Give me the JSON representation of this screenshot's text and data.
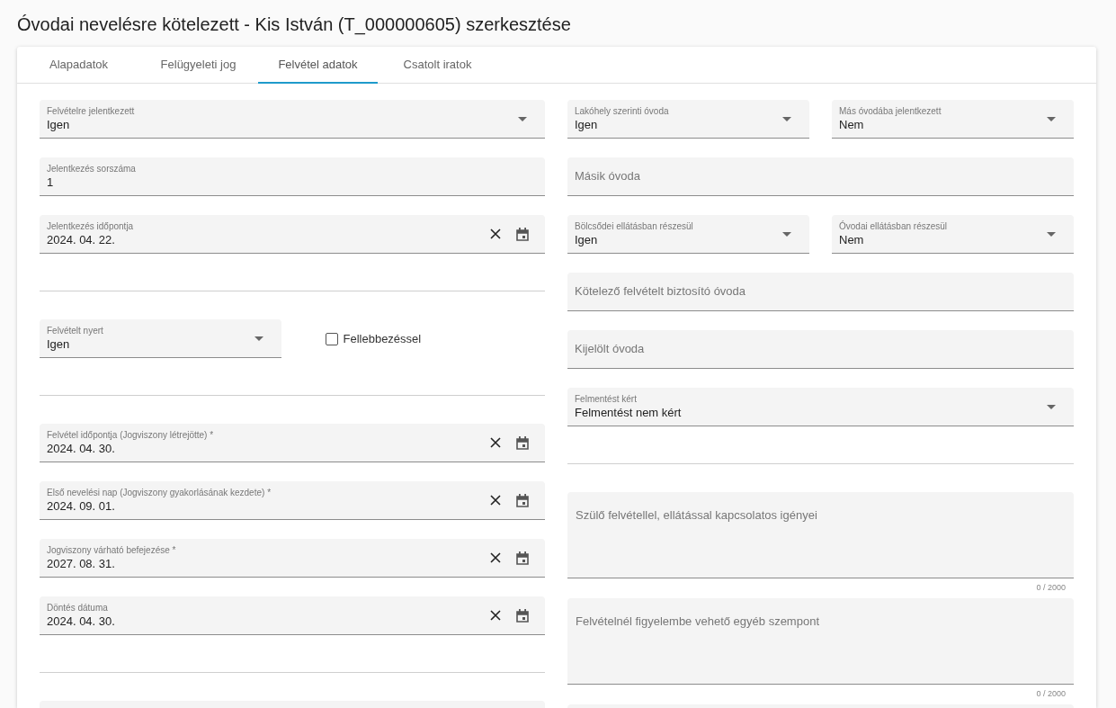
{
  "page_title": "Óvodai nevelésre kötelezett - Kis István (T_000000605) szerkesztése",
  "tabs": [
    {
      "label": "Alapadatok",
      "selected": false
    },
    {
      "label": "Felügyeleti jog",
      "selected": false
    },
    {
      "label": "Felvétel adatok",
      "selected": true
    },
    {
      "label": "Csatolt iratok",
      "selected": false
    }
  ],
  "left_column": [
    {
      "fields": [
        {
          "kind": "select",
          "label": "Felvételre jelentkezett",
          "value": "Igen"
        }
      ]
    },
    {
      "fields": [
        {
          "kind": "text",
          "label": "Jelentkezés sorszáma",
          "value": "1"
        }
      ]
    },
    {
      "fields": [
        {
          "kind": "date",
          "label": "Jelentkezés időpontja",
          "value": "2024. 04. 22."
        }
      ]
    },
    {
      "fields": [
        {
          "kind": "blank"
        }
      ]
    },
    {
      "fields": [
        {
          "kind": "select",
          "label": "Felvételt nyert",
          "value": "Igen"
        },
        {
          "kind": "checkbox",
          "label": "Fellebbezéssel",
          "checked": false
        }
      ]
    },
    {
      "fields": [
        {
          "kind": "blank"
        }
      ]
    },
    {
      "fields": [
        {
          "kind": "date",
          "label": "Felvétel időpontja (Jogviszony létrejötte) *",
          "value": "2024. 04. 30."
        }
      ]
    },
    {
      "fields": [
        {
          "kind": "date",
          "label": "Első nevelési nap (Jogviszony gyakorlásának kezdete) *",
          "value": "2024. 09. 01."
        }
      ]
    },
    {
      "fields": [
        {
          "kind": "date",
          "label": "Jogviszony várható befejezése *",
          "value": "2027. 08. 31."
        }
      ]
    },
    {
      "fields": [
        {
          "kind": "date",
          "label": "Döntés dátuma",
          "value": "2024. 04. 30."
        }
      ]
    },
    {
      "fields": [
        {
          "kind": "blank"
        }
      ]
    },
    {
      "fields": [
        {
          "kind": "partial"
        }
      ]
    }
  ],
  "right_column": [
    {
      "fields": [
        {
          "kind": "select",
          "label": "Lakóhely szerinti óvoda",
          "value": "Igen"
        },
        {
          "kind": "select",
          "label": "Más óvodába jelentkezett",
          "value": "Nem"
        }
      ]
    },
    {
      "fields": [
        {
          "kind": "text",
          "label": "Másik óvoda"
        }
      ]
    },
    {
      "fields": [
        {
          "kind": "select",
          "label": "Bölcsődei ellátásban részesül",
          "value": "Igen"
        },
        {
          "kind": "select",
          "label": "Óvodai ellátásban részesül",
          "value": "Nem"
        }
      ]
    },
    {
      "fields": [
        {
          "kind": "text",
          "label": "Kötelező felvételt biztosító óvoda"
        }
      ]
    },
    {
      "fields": [
        {
          "kind": "text",
          "label": "Kijelölt óvoda"
        }
      ]
    },
    {
      "fields": [
        {
          "kind": "select",
          "label": "Felmentést kért",
          "value": "Felmentést nem kért"
        }
      ]
    },
    {
      "fields": [
        {
          "kind": "blank"
        }
      ]
    },
    {
      "fields": [
        {
          "kind": "textarea",
          "label": "Szülő felvétellel, ellátással kapcsolatos igényei",
          "counter": "0 / 2000"
        }
      ]
    },
    {
      "fields": [
        {
          "kind": "textarea",
          "label": "Felvételnél figyelembe vehető egyéb szempont",
          "counter": "0 / 2000"
        }
      ]
    },
    {
      "fields": [
        {
          "kind": "partial"
        }
      ]
    }
  ]
}
